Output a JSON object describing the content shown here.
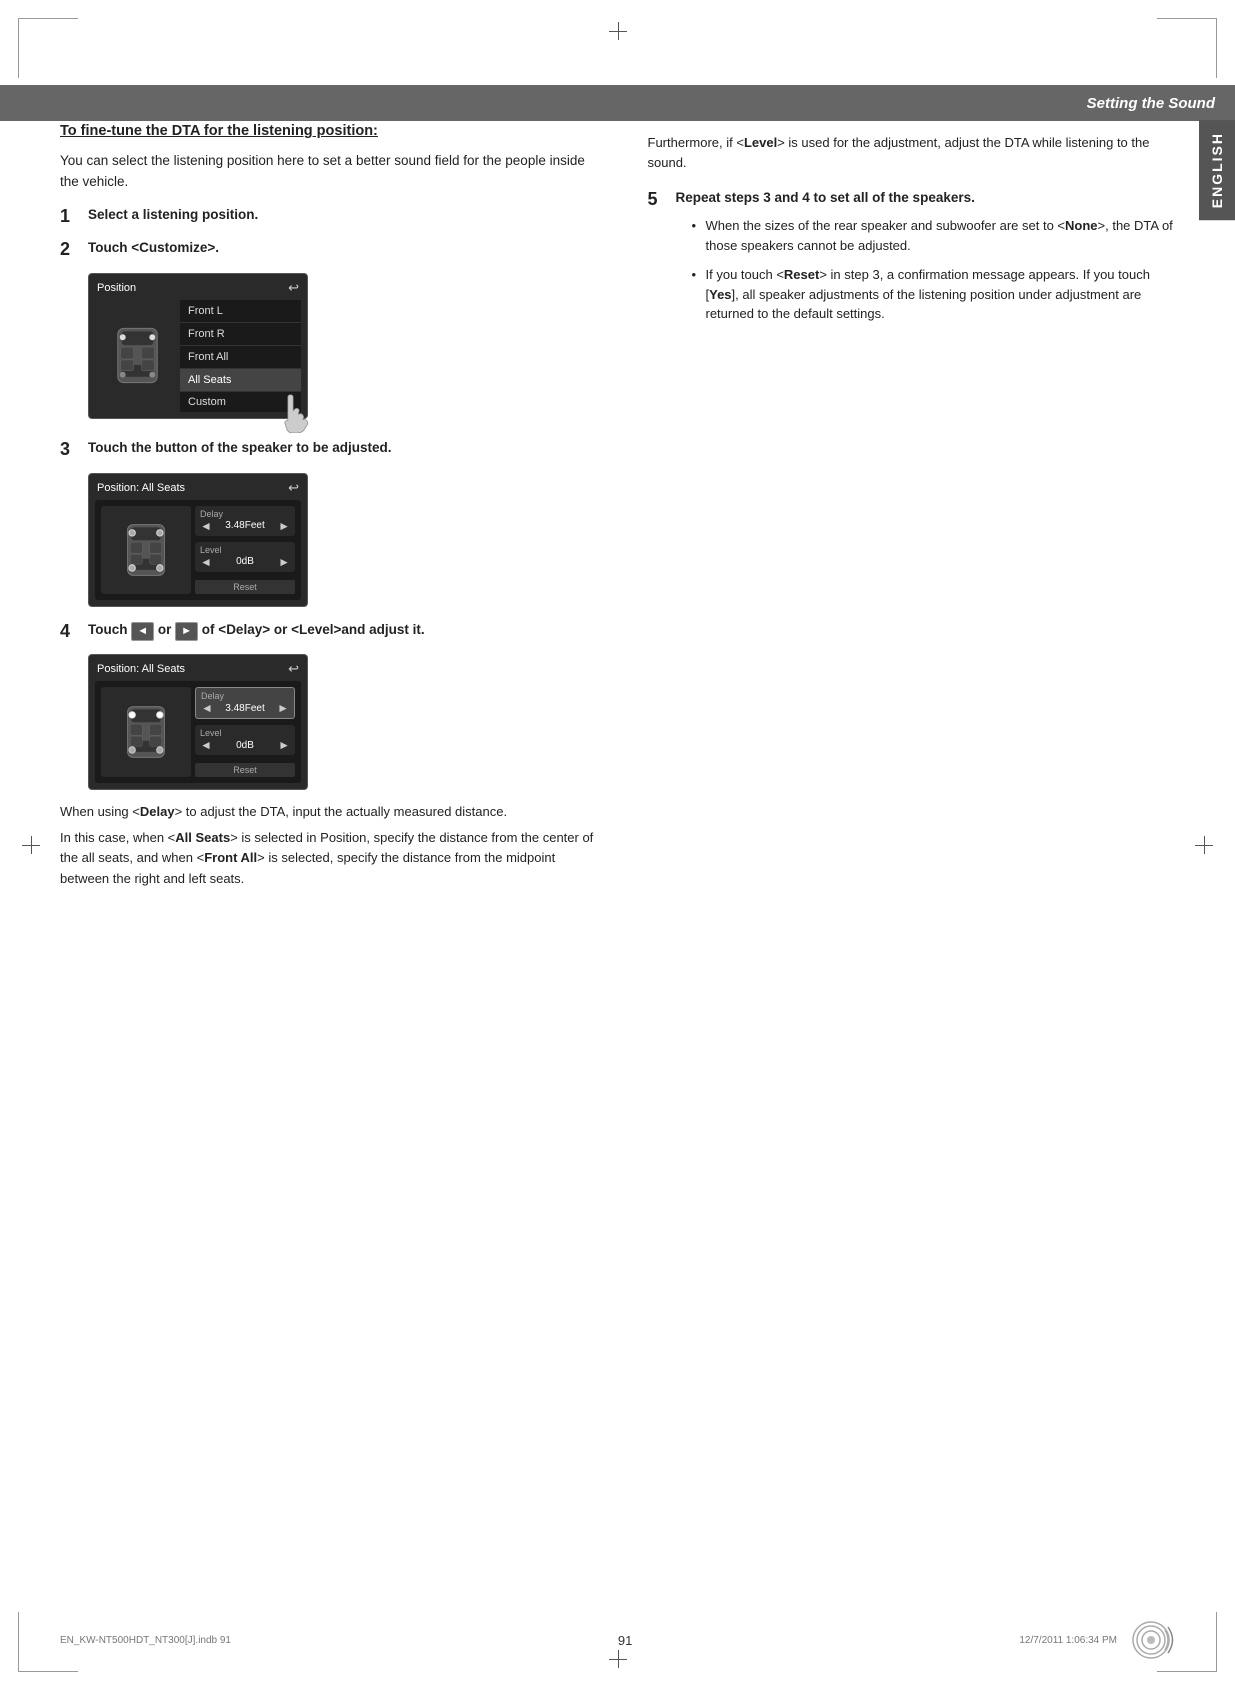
{
  "page": {
    "number": "91",
    "footer_left": "EN_KW-NT500HDT_NT300[J].indb  91",
    "footer_right": "12/7/2011  1:06:34 PM"
  },
  "header": {
    "title": "Setting the Sound"
  },
  "english_tab": "ENGLISH",
  "section": {
    "heading": "To fine-tune the DTA for the listening position:",
    "intro": "You can select the listening position here to set a better sound field for the people inside the vehicle.",
    "steps": [
      {
        "number": "1",
        "text": "Select a listening position."
      },
      {
        "number": "2",
        "text": "Touch <Customize>."
      },
      {
        "number": "3",
        "text": "Touch the button of the speaker to be adjusted."
      },
      {
        "number": "4",
        "text": "Touch  or  of <Delay> or <Level>and adjust it."
      },
      {
        "number": "5",
        "text": "Repeat steps 3 and 4 to set all of the speakers."
      }
    ],
    "step2_screen": {
      "title": "Position",
      "items": [
        "Front L",
        "Front R",
        "Front All",
        "All Seats"
      ],
      "custom": "Custom"
    },
    "step3_screen": {
      "title": "Position: All Seats",
      "delay_label": "Delay",
      "delay_value": "3.48Feet",
      "level_label": "Level",
      "level_value": "0dB",
      "reset": "Reset"
    },
    "step4_screen": {
      "title": "Position: All Seats",
      "delay_label": "Delay",
      "delay_value": "3.48Feet",
      "level_label": "Level",
      "level_value": "0dB",
      "reset": "Reset"
    },
    "when_using": {
      "para1": "When using <Delay> to adjust the DTA, input the actually measured distance.",
      "para2": "In this case, when <All Seats> is selected in Position, specify the distance from the center of the all seats, and when <Front All> is selected, specify the distance from the midpoint between the right and left seats."
    }
  },
  "right_col": {
    "furthermore_para": "Furthermore, if <Level> is used for the adjustment, adjust the DTA while listening to the sound.",
    "step5_bullets": [
      "When the sizes of the rear speaker and subwoofer are set to <None>, the DTA of those speakers cannot be adjusted.",
      "If you touch <Reset> in step 3, a confirmation message appears. If you touch [Yes], all speaker adjustments of the listening position under adjustment are returned to the default settings."
    ]
  }
}
